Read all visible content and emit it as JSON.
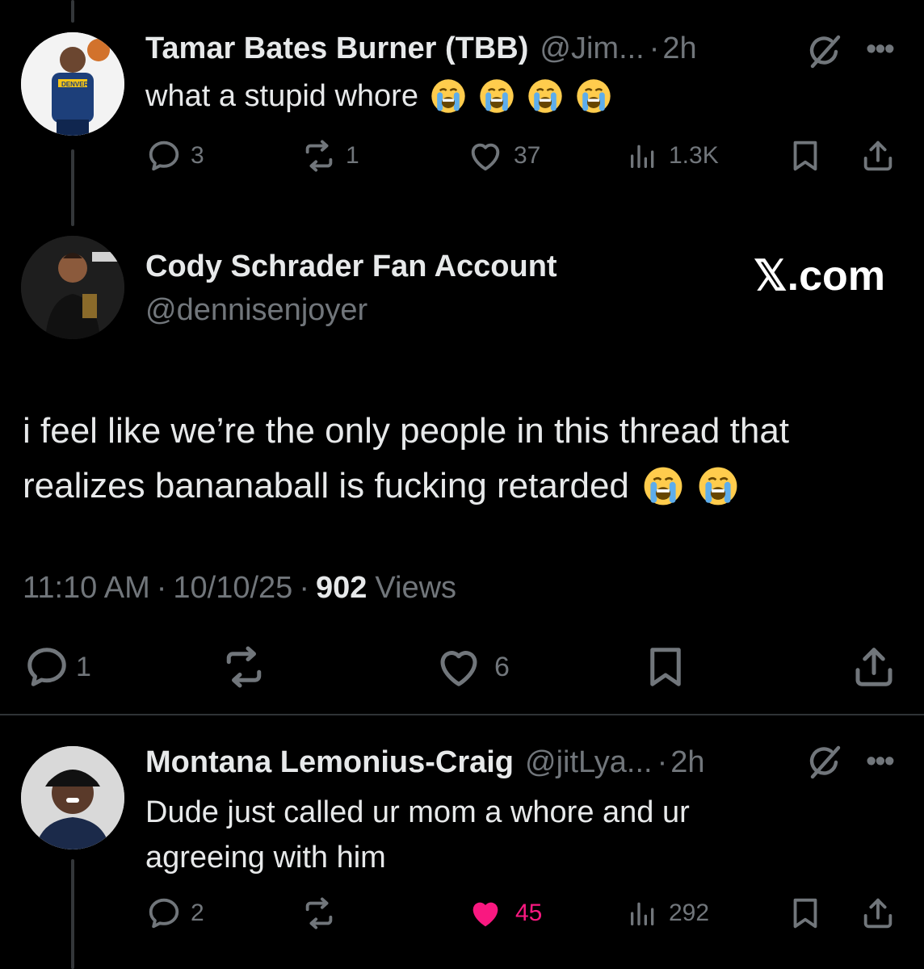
{
  "tweets": [
    {
      "name": "Tamar Bates Burner (TBB)",
      "handle": "@Jim...",
      "dot": "·",
      "time": "2h",
      "text": "what a stupid whore",
      "emoji_count": 4,
      "stats": {
        "replies": "3",
        "reposts": "1",
        "likes": "37",
        "views": "1.3K"
      },
      "avatar_text": "DENVER"
    },
    {
      "name": "Montana Lemonius-Craig",
      "handle": "@jitLya...",
      "dot": "·",
      "time": "2h",
      "text_line1": "Dude just called ur mom a whore and ur",
      "text_line2": "agreeing with him",
      "stats": {
        "replies": "2",
        "reposts": "",
        "likes": "45",
        "views": "292"
      },
      "liked": true
    }
  ],
  "main": {
    "name": "Cody Schrader Fan Account",
    "handle": "@dennisenjoyer",
    "brand": "𝕏.com",
    "text_line1": "i feel like we’re the only people in this thread that",
    "text_line2": "realizes bananaball is fucking retarded",
    "emoji_count": 2,
    "meta_time": "11:10 AM",
    "meta_sep1": "·",
    "meta_date": "10/10/25",
    "meta_sep2": "·",
    "meta_views_count": "902",
    "meta_views_label": "Views",
    "stats": {
      "replies": "1",
      "likes": "6"
    }
  },
  "colors": {
    "like_active": "#f91880",
    "muted": "#71767b",
    "text": "#e7e9ea",
    "divider": "#2f3336"
  },
  "icons": [
    "reply-icon",
    "repost-icon",
    "like-icon",
    "views-icon",
    "bookmark-icon",
    "share-icon",
    "grok-icon",
    "more-icon"
  ]
}
